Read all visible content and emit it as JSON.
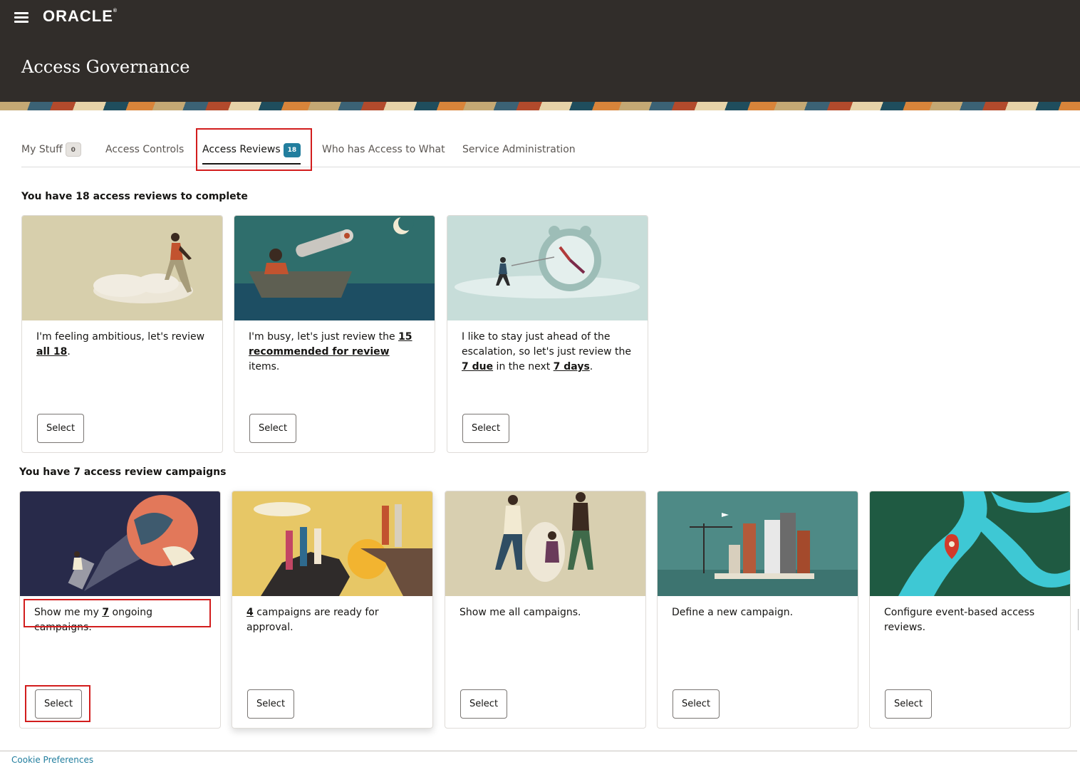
{
  "header": {
    "logo_text": "ORACLE",
    "logo_mark": "®",
    "app_title": "Access Governance"
  },
  "tabs": [
    {
      "label": "My Stuff",
      "badge": "0"
    },
    {
      "label": "Access Controls"
    },
    {
      "label": "Access Reviews",
      "badge": "18",
      "active": true
    },
    {
      "label": "Who has Access to What"
    },
    {
      "label": "Service Administration"
    }
  ],
  "reviews_section": {
    "heading": "You have 18 access reviews to complete",
    "cards": [
      {
        "text_before": "I'm feeling ambitious, let's review ",
        "link1": "all 18",
        "text_after": ".",
        "button": "Select",
        "image": "woman-climbing-clouds-illustration"
      },
      {
        "text_before": "I'm busy, let's just review the ",
        "link1": "15 recommended for review",
        "text_after": " items.",
        "button": "Select",
        "image": "telescope-boat-moon-illustration"
      },
      {
        "text_before": "I like to stay just ahead of the escalation, so let's just review the ",
        "link1": "7 due",
        "text_mid": " in the next ",
        "link2": "7 days",
        "text_after": ".",
        "button": "Select",
        "image": "man-pulling-clock-illustration"
      }
    ]
  },
  "campaigns_section": {
    "heading": "You have 7 access review campaigns",
    "cards": [
      {
        "text_before": "Show me my ",
        "link1": "7",
        "text_after": " ongoing campaigns.",
        "button": "Select",
        "image": "flashlight-globe-illustration"
      },
      {
        "text_before": "",
        "link1": "4",
        "text_after": " campaigns are ready for approval.",
        "button": "Select",
        "image": "people-cliff-hand-illustration"
      },
      {
        "text_before": "Show me all campaigns.",
        "button": "Select",
        "image": "people-lifting-jar-illustration"
      },
      {
        "text_before": "Define a new campaign.",
        "button": "Select",
        "image": "city-construction-illustration"
      },
      {
        "text_before": "Configure event-based access reviews.",
        "button": "Select",
        "image": "river-map-pin-illustration"
      }
    ]
  },
  "footer": {
    "cookie_link": "Cookie Preferences"
  },
  "colors": {
    "header_bg": "#312d2a",
    "accent": "#227e9e",
    "highlight": "#d21d1d"
  }
}
